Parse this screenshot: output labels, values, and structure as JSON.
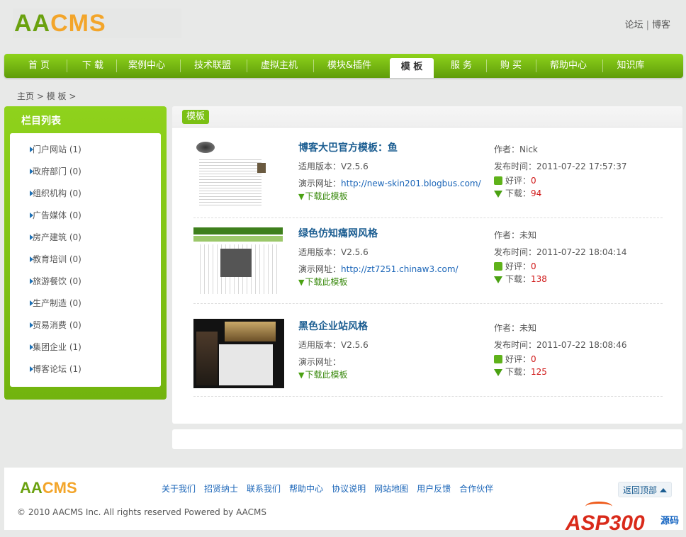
{
  "header": {
    "logo_aa": "AA",
    "logo_cms": "CMS",
    "links": [
      "论坛",
      "博客"
    ],
    "links_sep": "|"
  },
  "nav": {
    "items": [
      "首 页",
      "下 载",
      "案例中心",
      "技术联盟",
      "虚拟主机",
      "模块&插件",
      "模 板",
      "服 务",
      "购 买",
      "帮助中心",
      "知识库"
    ],
    "active_index": 6
  },
  "breadcrumb": {
    "home": "主页",
    "sep": " > ",
    "current": "模 板",
    "trail_end": " >"
  },
  "sidebar": {
    "title": "栏目列表",
    "items": [
      {
        "label": "门户网站 (1)"
      },
      {
        "label": "政府部门 (0)"
      },
      {
        "label": "组织机构 (0)"
      },
      {
        "label": "广告媒体 (0)"
      },
      {
        "label": "房产建筑 (0)"
      },
      {
        "label": "教育培训 (0)"
      },
      {
        "label": "旅游餐饮 (0)"
      },
      {
        "label": "生产制造 (0)"
      },
      {
        "label": "贸易消费 (0)"
      },
      {
        "label": "集团企业 (1)"
      },
      {
        "label": "博客论坛 (1)"
      }
    ]
  },
  "main": {
    "tag": "模板",
    "labels": {
      "version": "适用版本：",
      "demo": "演示网址：",
      "download": "下载此模板",
      "author": "作者：",
      "published": "发布时间：",
      "likes": "好评：",
      "downloads": "下载："
    },
    "items": [
      {
        "title": "博客大巴官方模板：鱼",
        "version": "V2.5.6",
        "demo_url": "http://new-skin201.blogbus.com/",
        "author": "Nick",
        "published": "2011-07-22 17:57:37",
        "likes": "0",
        "downloads": "94"
      },
      {
        "title": "绿色仿知痛网风格",
        "version": "V2.5.6",
        "demo_url": "http://zt7251.chinaw3.com/",
        "author": "未知",
        "published": "2011-07-22 18:04:14",
        "likes": "0",
        "downloads": "138"
      },
      {
        "title": "黑色企业站风格",
        "version": "V2.5.6",
        "demo_url": "",
        "author": "未知",
        "published": "2011-07-22 18:08:46",
        "likes": "0",
        "downloads": "125"
      }
    ]
  },
  "footer": {
    "logo_aa": "AA",
    "logo_cms": "CMS",
    "links": [
      "关于我们",
      "招贤纳士",
      "联系我们",
      "帮助中心",
      "协议说明",
      "网站地图",
      "用户反馈",
      "合作伙伴"
    ],
    "copyright": "© 2010 AACMS Inc. All rights reserved Powered by AACMS",
    "back_to_top": "返回顶部"
  },
  "watermark": {
    "text": "ASP300",
    "cn": "源码"
  },
  "colors": {
    "nav_green": "#6fb112",
    "link_blue": "#1a65b8",
    "count_red": "#d01818",
    "logo_orange": "#f3a52a"
  }
}
